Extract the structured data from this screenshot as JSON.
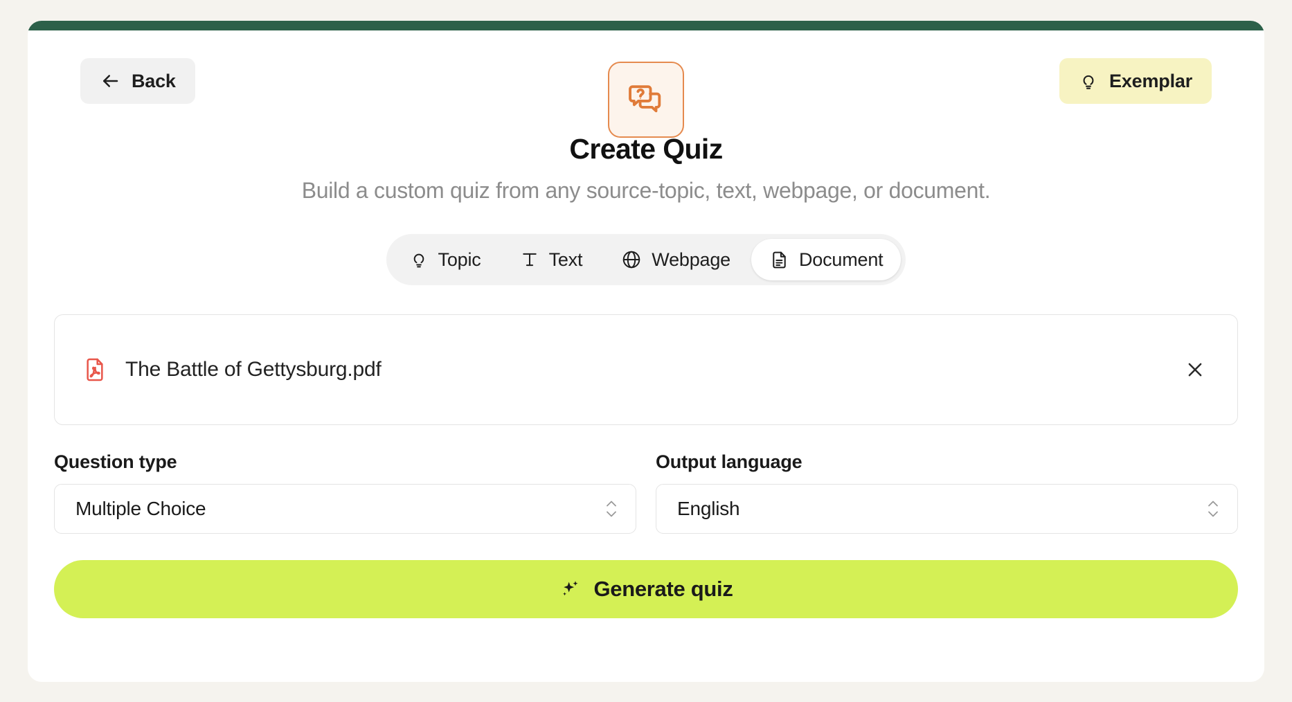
{
  "theme": {
    "page_background": "#F5F3EE",
    "card_background": "#FFFFFF",
    "topbar_green": "#2C6049",
    "accent_orange": "#E58A4E",
    "exemplar_yellow": "#F7F3C2",
    "generate_lime": "#D4F055",
    "pdf_red": "#E8564A"
  },
  "header": {
    "back_label": "Back",
    "back_icon": "arrow-left-icon",
    "exemplar_label": "Exemplar",
    "exemplar_icon": "lightbulb-icon",
    "hero_icon": "question-chat-bubbles-icon"
  },
  "hero": {
    "title": "Create Quiz",
    "subtitle": "Build a custom quiz from any source-topic, text, webpage, or document."
  },
  "source_tabs": {
    "selected": "Document",
    "items": [
      {
        "label": "Topic",
        "icon": "lightbulb-icon",
        "active": false
      },
      {
        "label": "Text",
        "icon": "text-t-icon",
        "active": false
      },
      {
        "label": "Webpage",
        "icon": "globe-icon",
        "active": false
      },
      {
        "label": "Document",
        "icon": "document-icon",
        "active": true
      }
    ]
  },
  "file_upload": {
    "file_name": "The Battle of Gettysburg.pdf",
    "file_icon": "pdf-file-icon",
    "remove_icon": "close-x-icon"
  },
  "fields": {
    "question_type": {
      "label": "Question type",
      "value": "Multiple Choice"
    },
    "output_language": {
      "label": "Output language",
      "value": "English"
    }
  },
  "generate": {
    "label": "Generate quiz",
    "icon": "sparkles-icon"
  }
}
